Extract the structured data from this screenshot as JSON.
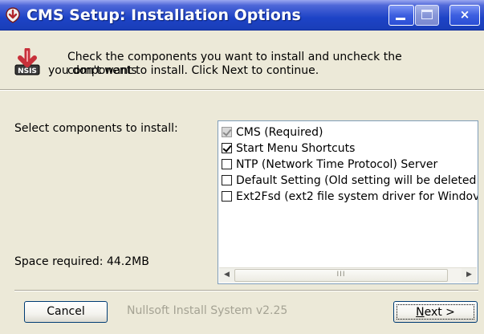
{
  "window": {
    "title": "CMS Setup: Installation Options",
    "title_icon": "nsis-installer-icon",
    "controls": {
      "minimize": "minimize-icon",
      "maximize": "maximize-icon",
      "close": "×"
    }
  },
  "header": {
    "icon": "nsis-logo-icon",
    "line1": "Check the components you want to install and uncheck the components",
    "line2": "you don't want to install. Click Next to continue."
  },
  "main": {
    "select_label": "Select components to install:",
    "space_required": "Space required: 44.2MB",
    "components": [
      {
        "label": "CMS (Required)",
        "checked": true,
        "disabled": true
      },
      {
        "label": "Start Menu Shortcuts",
        "checked": true,
        "disabled": false
      },
      {
        "label": "NTP (Network Time Protocol) Server",
        "checked": false,
        "disabled": false
      },
      {
        "label": "Default Setting (Old setting will be deleted!",
        "checked": false,
        "disabled": false
      },
      {
        "label": "Ext2Fsd (ext2 file system driver for Windov",
        "checked": false,
        "disabled": false
      }
    ],
    "scroll": {
      "left_arrow": "◀",
      "right_arrow": "▶",
      "thumb_grip": "III"
    }
  },
  "footer": {
    "branding": "Nullsoft Install System v2.25",
    "cancel_label": "Cancel",
    "next_mnemonic": "N",
    "next_rest": "ext >"
  },
  "colors": {
    "titlebar": "#1d43c6",
    "window_bg": "#ece9d8",
    "branding_text": "#a5a394",
    "button_border": "#003c74"
  }
}
